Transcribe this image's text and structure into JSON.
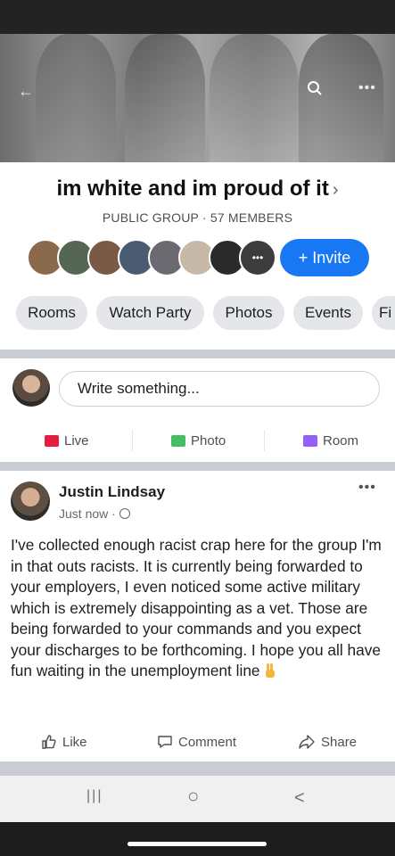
{
  "group": {
    "title": "im white and im proud of it",
    "title_chevron": "›",
    "meta": "PUBLIC GROUP · 57 MEMBERS",
    "invite_label": "+ Invite"
  },
  "tabs": [
    "Rooms",
    "Watch Party",
    "Photos",
    "Events",
    "Fi"
  ],
  "composer": {
    "placeholder": "Write something...",
    "actions": [
      {
        "label": "Live",
        "color": "#e41e3f",
        "icon": "live-icon"
      },
      {
        "label": "Photo",
        "color": "#45bd62",
        "icon": "photo-icon"
      },
      {
        "label": "Room",
        "color": "#9360f7",
        "icon": "room-icon"
      }
    ]
  },
  "post": {
    "author": "Justin Lindsay",
    "time": "Just now ·",
    "text": "I've collected enough racist crap here for the group I'm in that outs racists. It is currently being forwarded to your employers, I even noticed some active military which is extremely disappointing as a vet. Those are being forwarded to your commands and you expect your discharges to be forthcoming. I hope you all have fun waiting in the unemployment line",
    "actions": [
      "Like",
      "Comment",
      "Share"
    ]
  },
  "nav": {
    "recent": "|||",
    "home": "○",
    "back": "<"
  },
  "colors": {
    "accent": "#1877f2",
    "chip": "#e4e6eb",
    "separator": "#c9ccd1"
  }
}
